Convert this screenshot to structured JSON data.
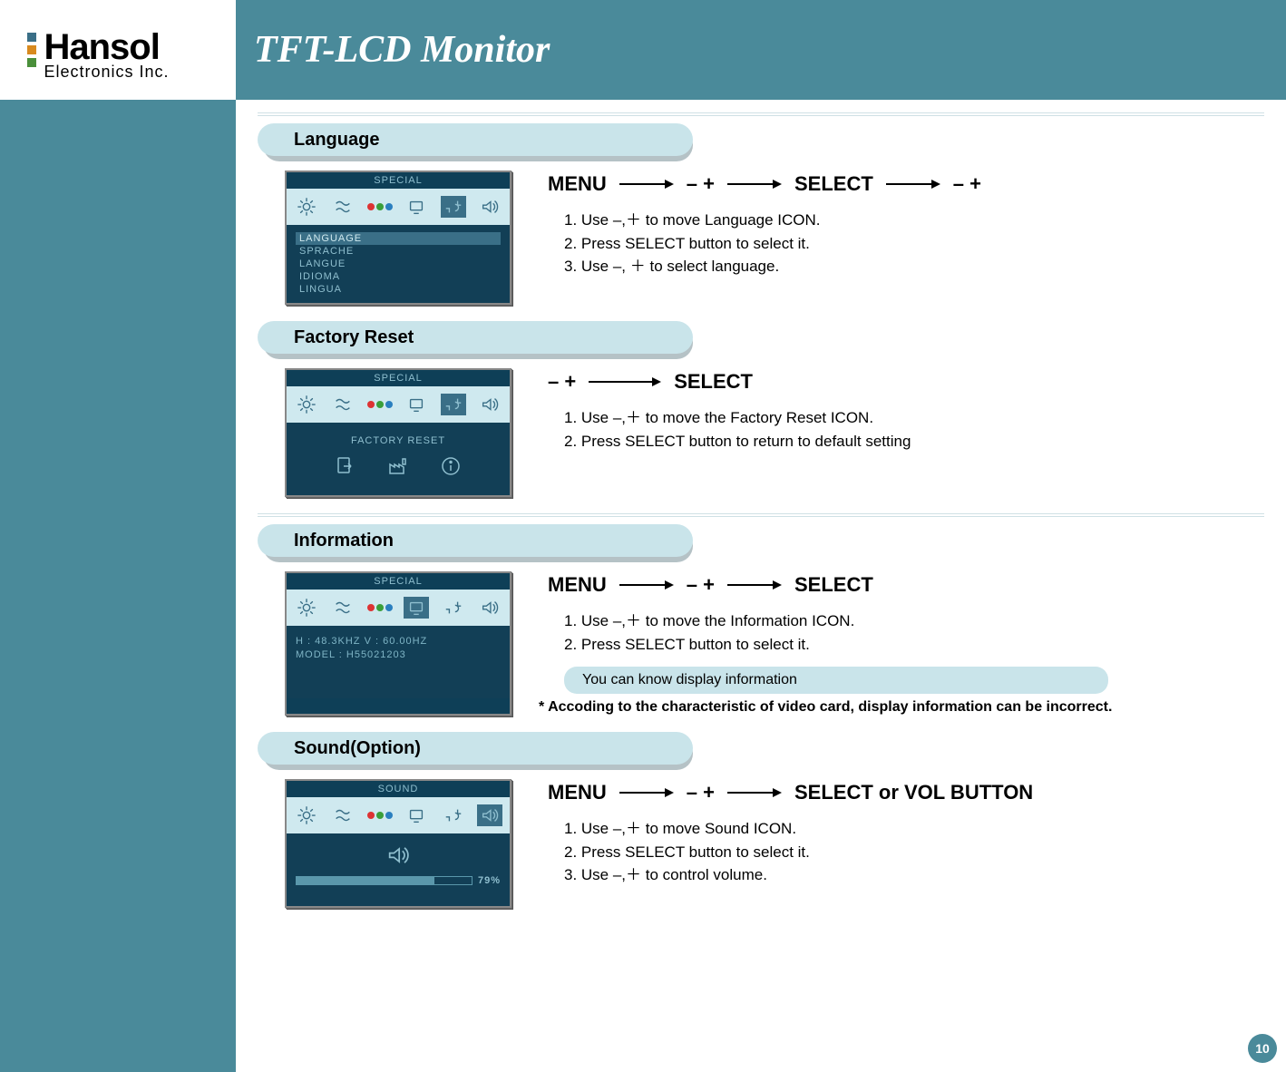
{
  "logo": {
    "title": "Hansol",
    "subtitle": "Electronics Inc."
  },
  "header": {
    "title": "TFT-LCD Monitor"
  },
  "page_number": "10",
  "sections": {
    "language": {
      "heading": "Language",
      "osd_title": "SPECIAL",
      "osd_items": [
        "LANGUAGE",
        "SPRACHE",
        "LANGUE",
        "IDIOMA",
        "LINGUA"
      ],
      "flow": [
        "MENU",
        "–  +",
        "SELECT",
        "–  +"
      ],
      "steps": [
        "1. Use –,＋ to move Language ICON.",
        "2. Press SELECT button to select it.",
        "3. Use –, ＋ to select language."
      ]
    },
    "factory": {
      "heading": "Factory Reset",
      "osd_title": "SPECIAL",
      "osd_caption": "FACTORY RESET",
      "flow": [
        "–  +",
        "SELECT"
      ],
      "steps": [
        "1. Use –,＋ to move the Factory Reset ICON.",
        "2. Press SELECT button to return to default setting"
      ]
    },
    "information": {
      "heading": "Information",
      "osd_title": "SPECIAL",
      "osd_info_line1": "H : 48.3KHZ  V : 60.00HZ",
      "osd_info_line2": "MODEL : H55021203",
      "flow": [
        "MENU",
        "–  +",
        "SELECT"
      ],
      "steps": [
        "1. Use –,＋ to move the Information ICON.",
        "2. Press SELECT button to select it."
      ],
      "pill": "You can know display information",
      "footnote": "* Accoding to the characteristic of video card, display information can be incorrect."
    },
    "sound": {
      "heading": "Sound(Option)",
      "osd_title": "SOUND",
      "slider_pct": 79,
      "slider_label": "79%",
      "flow": [
        "MENU",
        "–  +",
        "SELECT or  VOL BUTTON"
      ],
      "steps": [
        "1. Use –,＋ to move Sound ICON.",
        "2. Press SELECT button to select it.",
        "3. Use –,＋ to control volume."
      ]
    }
  }
}
